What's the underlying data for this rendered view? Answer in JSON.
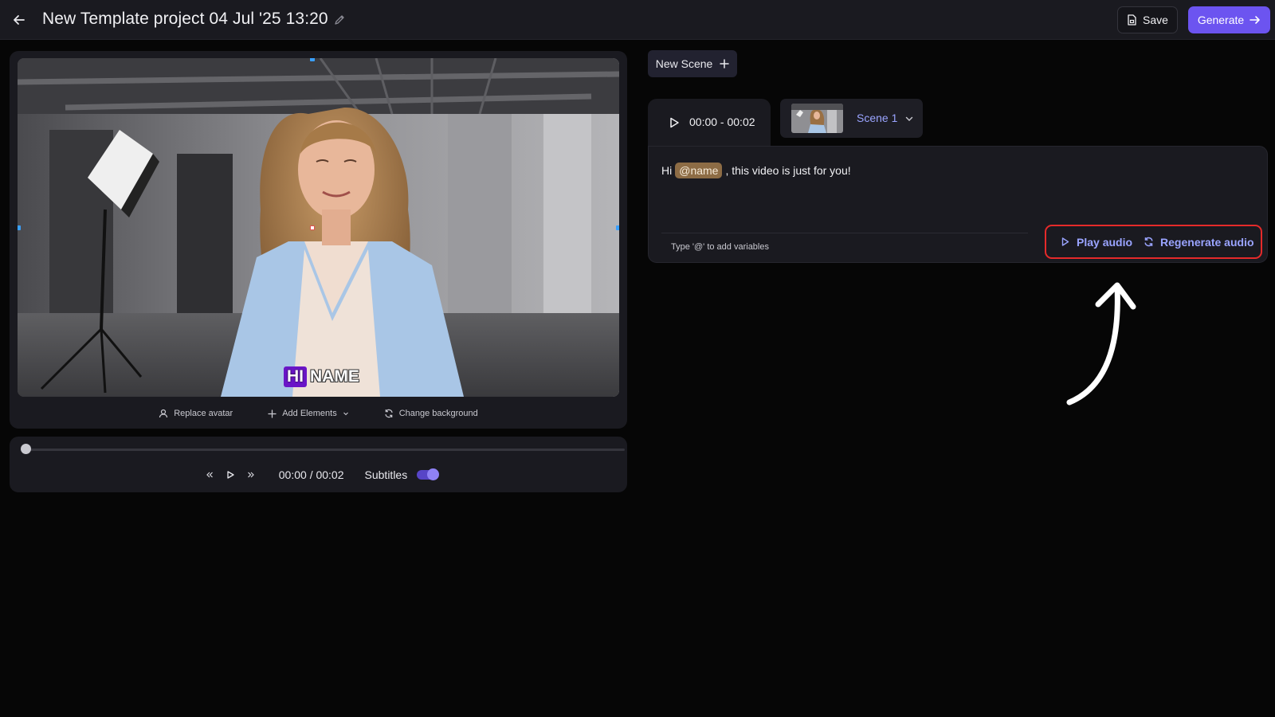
{
  "header": {
    "title": "New Template project 04 Jul '25 13:20",
    "save_label": "Save",
    "generate_label": "Generate"
  },
  "preview": {
    "subtitle_hi": "HI",
    "subtitle_name": "NAME",
    "actions": [
      {
        "label": "Replace avatar",
        "icon": "user-icon"
      },
      {
        "label": "Add Elements",
        "icon": "plus-icon"
      },
      {
        "label": "Change background",
        "icon": "refresh-icon"
      }
    ]
  },
  "player": {
    "time": "00:00 / 00:02",
    "progress": 0,
    "subtitles_label": "Subtitles",
    "subtitles_enabled": true
  },
  "scenes": {
    "new_scene_label": "New Scene",
    "active_tab_time": "00:00 - 00:02",
    "selected_scene": "Scene 1"
  },
  "script": {
    "prefix": "Hi",
    "variable": "@name",
    "suffix": ", this video is just for you!",
    "hint": "Type '@' to add variables",
    "play_audio_label": "Play audio",
    "regenerate_audio_label": "Regenerate audio"
  },
  "colors": {
    "accent": "#6c54f0",
    "link": "#9aa4ff",
    "highlight_box": "#e52a2a",
    "variable_chip": "#8d6c45"
  }
}
